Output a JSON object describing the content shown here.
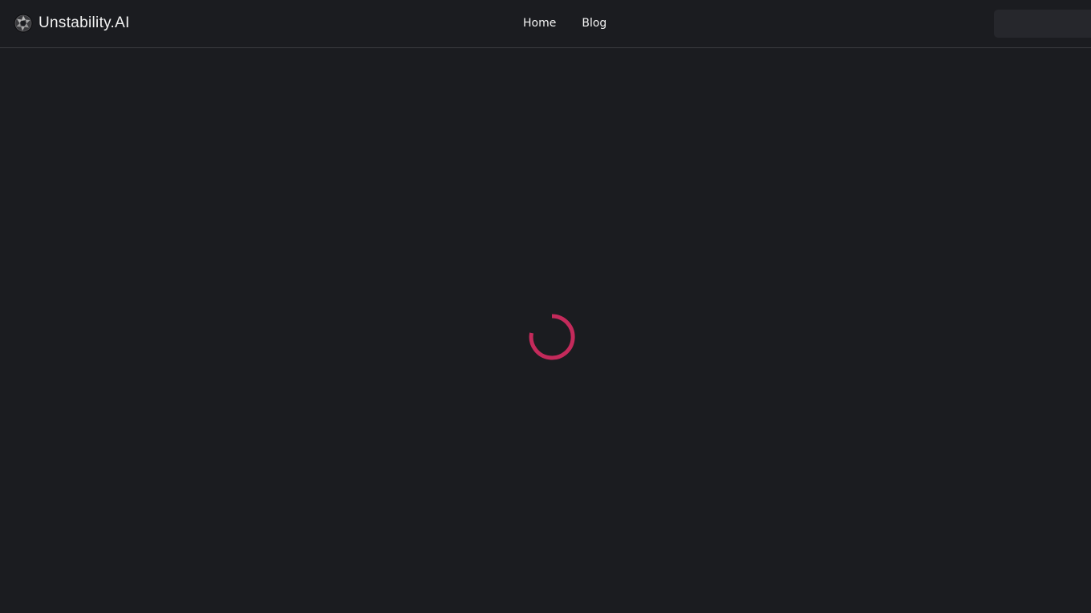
{
  "header": {
    "brand": {
      "name": "Unstability.AI",
      "logo_icon": "aperture-logo-icon"
    },
    "nav": {
      "items": [
        {
          "label": "Home"
        },
        {
          "label": "Blog"
        }
      ]
    },
    "action_button": {
      "label": ""
    }
  },
  "main": {
    "status": "loading",
    "spinner": {
      "icon": "loading-spinner-icon",
      "color": "#c42a5b"
    }
  },
  "colors": {
    "background": "#1b1c20",
    "header_border": "#3a3b40",
    "text": "#f2f2f2",
    "accent": "#c42a5b",
    "button_bg": "#26272c"
  }
}
